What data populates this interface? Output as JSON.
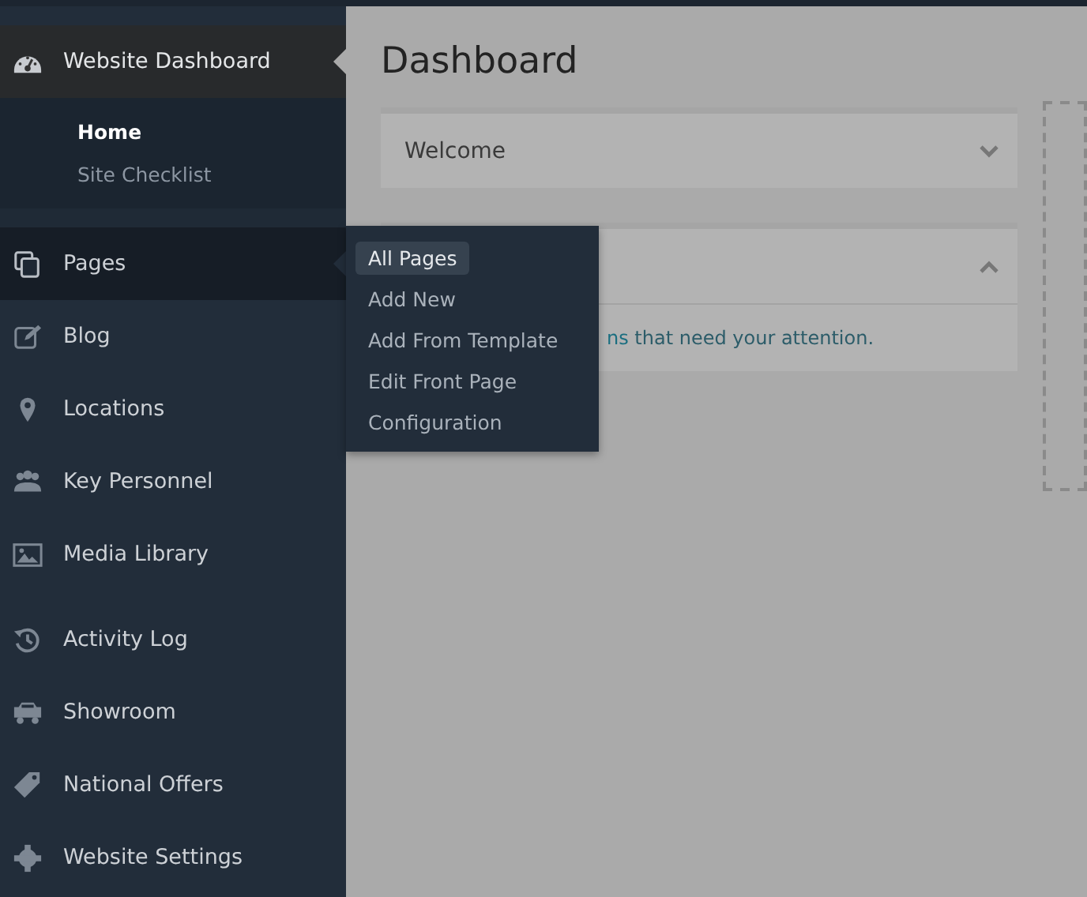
{
  "sidebar": {
    "sections": [
      {
        "items": [
          {
            "label": "Website Dashboard",
            "selected": true,
            "hovered": false,
            "children": [
              {
                "label": "Home",
                "selected": true
              },
              {
                "label": "Site Checklist",
                "selected": false
              }
            ]
          },
          {
            "label": "Pages",
            "selected": false,
            "hovered": true
          },
          {
            "label": "Blog",
            "selected": false,
            "hovered": false
          },
          {
            "label": "Locations",
            "selected": false,
            "hovered": false
          },
          {
            "label": "Key Personnel",
            "selected": false,
            "hovered": false
          },
          {
            "label": "Media Library",
            "selected": false,
            "hovered": false
          }
        ]
      },
      {
        "items": [
          {
            "label": "Activity Log",
            "selected": false,
            "hovered": false
          },
          {
            "label": "Showroom",
            "selected": false,
            "hovered": false
          },
          {
            "label": "National Offers",
            "selected": false,
            "hovered": false
          },
          {
            "label": "Website Settings",
            "selected": false,
            "hovered": false
          }
        ]
      }
    ]
  },
  "flyout": {
    "items": [
      {
        "label": "All Pages",
        "selected": true
      },
      {
        "label": "Add New",
        "selected": false
      },
      {
        "label": "Add From Template",
        "selected": false
      },
      {
        "label": "Edit Front Page",
        "selected": false
      },
      {
        "label": "Configuration",
        "selected": false
      }
    ]
  },
  "main": {
    "title": "Dashboard",
    "panels": [
      {
        "title": "Welcome",
        "expanded": false
      },
      {
        "expanded": true,
        "link": "ns",
        "text": " that need your attention."
      }
    ]
  }
}
